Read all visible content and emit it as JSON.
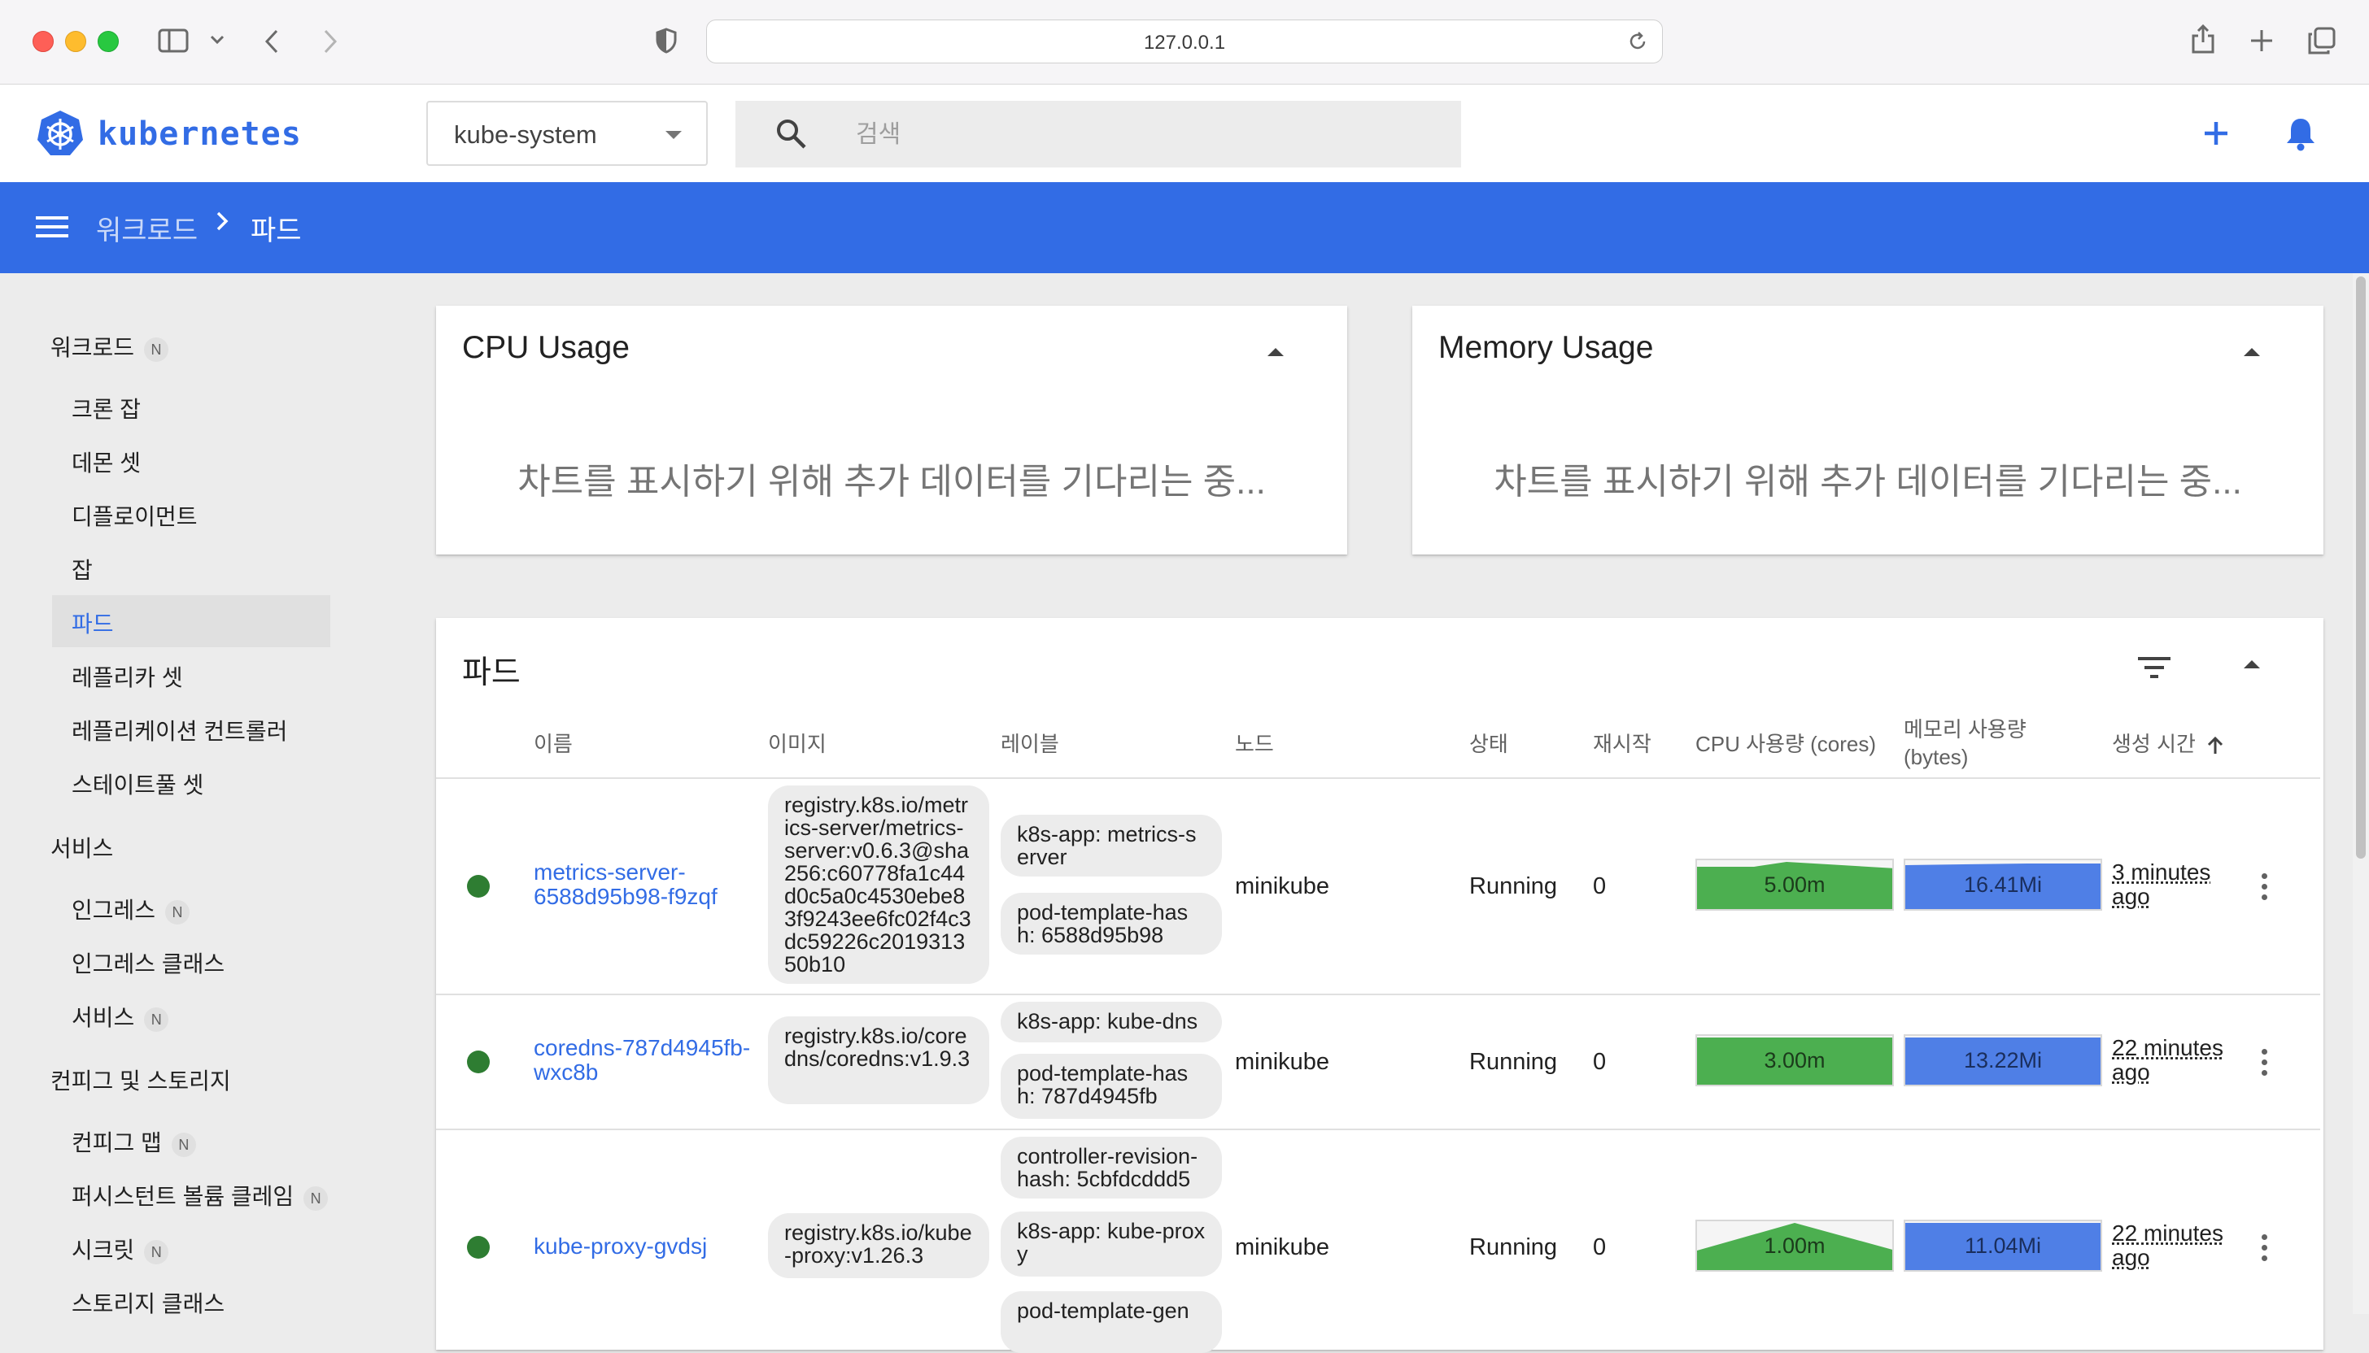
{
  "browser": {
    "url": "127.0.0.1"
  },
  "header": {
    "logo_text": "kubernetes",
    "namespace": "kube-system",
    "search_placeholder": "검색"
  },
  "breadcrumb": {
    "parent": "워크로드",
    "separator": ">",
    "current": "파드"
  },
  "sidebar": {
    "sections": [
      {
        "title": "워크로드",
        "badge": "N"
      },
      {
        "title": "서비스"
      },
      {
        "title": "컨피그 및 스토리지"
      }
    ],
    "workload_items": [
      "크론 잡",
      "데몬 셋",
      "디플로이먼트",
      "잡",
      "파드",
      "레플리카 셋",
      "레플리케이션 컨트롤러",
      "스테이트풀 셋"
    ],
    "service_items": [
      {
        "label": "인그레스",
        "badge": "N"
      },
      {
        "label": "인그레스 클래스"
      },
      {
        "label": "서비스",
        "badge": "N"
      }
    ],
    "config_items": [
      {
        "label": "컨피그 맵",
        "badge": "N"
      },
      {
        "label": "퍼시스턴트 볼륨 클레임",
        "badge": "N"
      },
      {
        "label": "시크릿",
        "badge": "N"
      },
      {
        "label": "스토리지 클래스"
      }
    ],
    "active_item": "파드"
  },
  "cpu_card": {
    "title": "CPU Usage",
    "message": "차트를 표시하기 위해 추가 데이터를 기다리는 중..."
  },
  "memory_card": {
    "title": "Memory Usage",
    "message": "차트를 표시하기 위해 추가 데이터를 기다리는 중..."
  },
  "pods_table": {
    "title": "파드",
    "columns": {
      "name": "이름",
      "image": "이미지",
      "labels": "레이블",
      "node": "노드",
      "status": "상태",
      "restarts": "재시작",
      "cpu": "CPU 사용량 (cores)",
      "memory_line1": "메모리 사용량",
      "memory_line2": "(bytes)",
      "age": "생성 시간"
    },
    "rows": [
      {
        "name": "metrics-server-6588d95b98-f9zqf",
        "image": "registry.k8s.io/metrics-server/metrics-server:v0.6.3@sha256:c60778fa1c44d0c5a0c4530ebe83f9243ee6fc02f4c3dc59226c201931350b10",
        "labels": [
          "k8s-app: metrics-server",
          "pod-template-hash: 6588d95b98"
        ],
        "node": "minikube",
        "status": "Running",
        "restarts": "0",
        "cpu": "5.00m",
        "memory": "16.41Mi",
        "age_line1": "3 minutes",
        "age_line2": "ago"
      },
      {
        "name": "coredns-787d4945fb-wxc8b",
        "image": "registry.k8s.io/coredns/coredns:v1.9.3",
        "labels": [
          "k8s-app: kube-dns",
          "pod-template-hash: 787d4945fb"
        ],
        "node": "minikube",
        "status": "Running",
        "restarts": "0",
        "cpu": "3.00m",
        "memory": "13.22Mi",
        "age_line1": "22 minutes",
        "age_line2": "ago"
      },
      {
        "name": "kube-proxy-gvdsj",
        "image": "registry.k8s.io/kube-proxy:v1.26.3",
        "labels": [
          "controller-revision-hash: 5cbfdcddd5",
          "k8s-app: kube-proxy",
          "pod-template-gen"
        ],
        "node": "minikube",
        "status": "Running",
        "restarts": "0",
        "cpu": "1.00m",
        "memory": "11.04Mi",
        "age_line1": "22 minutes",
        "age_line2": "ago"
      }
    ]
  },
  "colors": {
    "brand_blue": "#326ce5",
    "running_green": "#2e7d32",
    "cpu_spark": "#4caf50",
    "memory_spark": "#4f7fe6"
  }
}
